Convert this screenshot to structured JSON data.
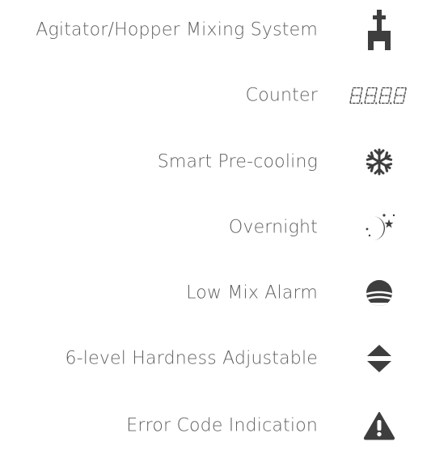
{
  "features": [
    {
      "label": "Agitator/Hopper Mixing System",
      "icon": "agitator-icon"
    },
    {
      "label": "Counter",
      "icon": "segment-counter-icon",
      "icon_text": "8.8.8.8"
    },
    {
      "label": "Smart Pre-cooling",
      "icon": "snowflake-icon"
    },
    {
      "label": "Overnight",
      "icon": "moon-stars-icon"
    },
    {
      "label": "Low Mix Alarm",
      "icon": "low-mix-alarm-icon"
    },
    {
      "label": "6-level Hardness Adjustable",
      "icon": "up-down-arrows-icon"
    },
    {
      "label": "Error Code Indication",
      "icon": "warning-triangle-icon"
    }
  ],
  "colors": {
    "text": "#5f5f5f",
    "icon": "#3e3e3e"
  }
}
